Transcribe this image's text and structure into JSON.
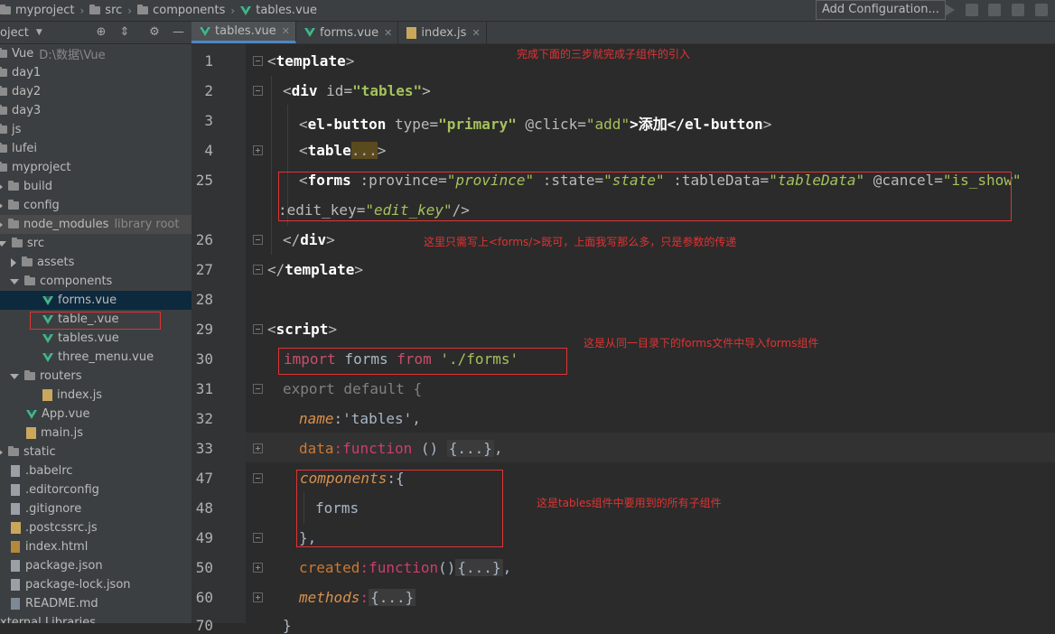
{
  "breadcrumb": {
    "items": [
      "myproject",
      "src",
      "components",
      "tables.vue"
    ]
  },
  "toolbar": {
    "add_configuration": "Add Configuration..."
  },
  "project": {
    "title": "oject",
    "dropdown": "▼"
  },
  "tree": [
    {
      "label": "Vue",
      "hint": "D:\\数据\\Vue"
    },
    {
      "label": "day1"
    },
    {
      "label": "day2"
    },
    {
      "label": "day3"
    },
    {
      "label": "js"
    },
    {
      "label": "lufei"
    },
    {
      "label": "myproject"
    },
    {
      "label": "build"
    },
    {
      "label": "config"
    },
    {
      "label": "node_modules",
      "hint": "library root"
    },
    {
      "label": "src"
    },
    {
      "label": "assets"
    },
    {
      "label": "components"
    },
    {
      "label": "forms.vue"
    },
    {
      "label": "table_.vue"
    },
    {
      "label": "tables.vue"
    },
    {
      "label": "three_menu.vue"
    },
    {
      "label": "routers"
    },
    {
      "label": "index.js"
    },
    {
      "label": "App.vue"
    },
    {
      "label": "main.js"
    },
    {
      "label": "static"
    },
    {
      "label": ".babelrc"
    },
    {
      "label": ".editorconfig"
    },
    {
      "label": ".gitignore"
    },
    {
      "label": ".postcssrc.js"
    },
    {
      "label": "index.html"
    },
    {
      "label": "package.json"
    },
    {
      "label": "package-lock.json"
    },
    {
      "label": "README.md"
    },
    {
      "label": "xternal Libraries"
    }
  ],
  "tabs": [
    {
      "label": "tables.vue"
    },
    {
      "label": "forms.vue"
    },
    {
      "label": "index.js"
    }
  ],
  "line_numbers": [
    "1",
    "2",
    "3",
    "4",
    "25",
    "",
    "26",
    "27",
    "28",
    "29",
    "30",
    "31",
    "32",
    "33",
    "47",
    "48",
    "49",
    "50",
    "60",
    "70"
  ],
  "notes": {
    "n1": "完成下面的三步就完成子组件的引入",
    "n2": "这里只需写上<forms/>既可，上面我写那么多，只是参数的传递",
    "n3": "这是从同一目录下的forms文件中导入forms组件",
    "n4": "这是tables组件中要用到的所有子组件"
  },
  "code": {
    "l1a": "<",
    "l1b": "template",
    "l1c": ">",
    "l2a": "<",
    "l2b": "div ",
    "l2c": "id=",
    "l2d": "\"tables\"",
    "l2e": ">",
    "l3a": "<",
    "l3b": "el-button ",
    "l3c": "type=",
    "l3d": "\"primary\"",
    "l3e": " @click=",
    "l3f": "\"add\"",
    "l3g": ">添加</",
    "l3h": "el-button",
    "l3i": ">",
    "l4a": "<",
    "l4b": "table",
    "l4c": "...",
    "l4d": ">",
    "l25a": "<",
    "l25b": "forms ",
    "l25c": ":province=",
    "l25d": "\"province\"",
    "l25e": " :state=",
    "l25f": "\"state\"",
    "l25g": " :tableData=",
    "l25h": "\"tableData\"",
    "l25i": " @cancel=",
    "l25j": "\"is_show\"",
    "l25k": ":edit_key=",
    "l25l": "\"edit_key\"",
    "l25m": "/>",
    "l26a": "</",
    "l26b": "div",
    "l26c": ">",
    "l27a": "</",
    "l27b": "template",
    "l27c": ">",
    "l29a": "<",
    "l29b": "script",
    "l29c": ">",
    "l30a": "import",
    "l30b": " forms ",
    "l30c": "from",
    "l30d": " './forms'",
    "l31": "export default {",
    "l32a": "name",
    "l32b": ":'tables',",
    "l33a": "data",
    "l33b": ":",
    "l33c": "function",
    "l33d": " () ",
    "l33e": "{...}",
    "l33f": ",",
    "l47a": "components",
    "l47b": ":{",
    "l48": "forms",
    "l49": "},",
    "l50a": "created",
    "l50b": ":",
    "l50c": "function",
    "l50d": "()",
    "l50e": "{...}",
    "l50f": ",",
    "l60a": "methods",
    "l60b": ":",
    "l60c": "{...}"
  }
}
